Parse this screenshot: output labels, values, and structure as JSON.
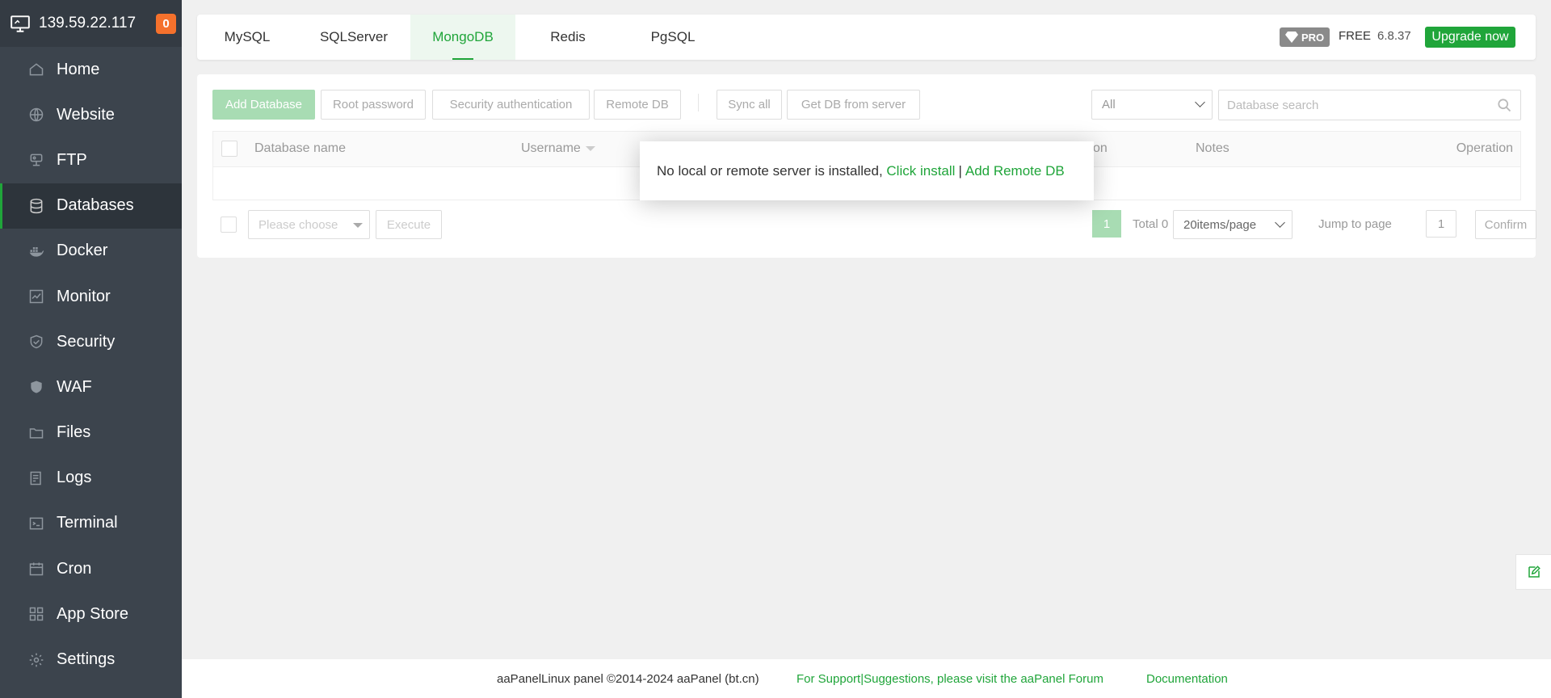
{
  "server": {
    "ip": "139.59.22.117",
    "badge": "0"
  },
  "sidebar": {
    "items": [
      {
        "label": "Home",
        "icon": "home-icon"
      },
      {
        "label": "Website",
        "icon": "globe-icon"
      },
      {
        "label": "FTP",
        "icon": "ftp-icon"
      },
      {
        "label": "Databases",
        "icon": "database-icon",
        "active": true
      },
      {
        "label": "Docker",
        "icon": "docker-icon"
      },
      {
        "label": "Monitor",
        "icon": "monitor-icon"
      },
      {
        "label": "Security",
        "icon": "shield-icon"
      },
      {
        "label": "WAF",
        "icon": "waf-shield-icon"
      },
      {
        "label": "Files",
        "icon": "folder-icon"
      },
      {
        "label": "Logs",
        "icon": "log-icon"
      },
      {
        "label": "Terminal",
        "icon": "terminal-icon"
      },
      {
        "label": "Cron",
        "icon": "calendar-icon"
      },
      {
        "label": "App Store",
        "icon": "apps-grid-icon"
      },
      {
        "label": "Settings",
        "icon": "gear-icon"
      }
    ]
  },
  "tabs": [
    {
      "label": "MySQL"
    },
    {
      "label": "SQLServer"
    },
    {
      "label": "MongoDB",
      "active": true
    },
    {
      "label": "Redis"
    },
    {
      "label": "PgSQL"
    }
  ],
  "header": {
    "pro_label": "PRO",
    "edition": "FREE",
    "version": "6.8.37",
    "upgrade_label": "Upgrade now"
  },
  "toolbar": {
    "add_database": "Add Database",
    "root_password": "Root password",
    "security_auth": "Security authentication",
    "remote_db": "Remote DB",
    "sync_all": "Sync all",
    "get_db": "Get DB from server",
    "filter_value": "All",
    "search_placeholder": "Database search"
  },
  "table": {
    "columns": {
      "name": "Database name",
      "username": "Username",
      "partial": "on",
      "notes": "Notes",
      "operation": "Operation"
    }
  },
  "batch": {
    "select_placeholder": "Please choose",
    "execute": "Execute"
  },
  "pagination": {
    "current": "1",
    "total": "Total 0",
    "per_page": "20items/page",
    "jump_label": "Jump to page",
    "jump_value": "1",
    "confirm": "Confirm"
  },
  "popup": {
    "message": "No local or remote server is installed,",
    "install_link": "Click install",
    "separator": "|",
    "remote_link": "Add Remote DB"
  },
  "footer": {
    "copyright": "aaPanelLinux panel ©2014-2024 aaPanel (bt.cn)",
    "support": "For Support|Suggestions, please visit the aaPanel Forum",
    "docs": "Documentation"
  },
  "colors": {
    "accent": "#20a53a",
    "sidebar_bg": "#3c444d",
    "badge": "#f5712c"
  }
}
